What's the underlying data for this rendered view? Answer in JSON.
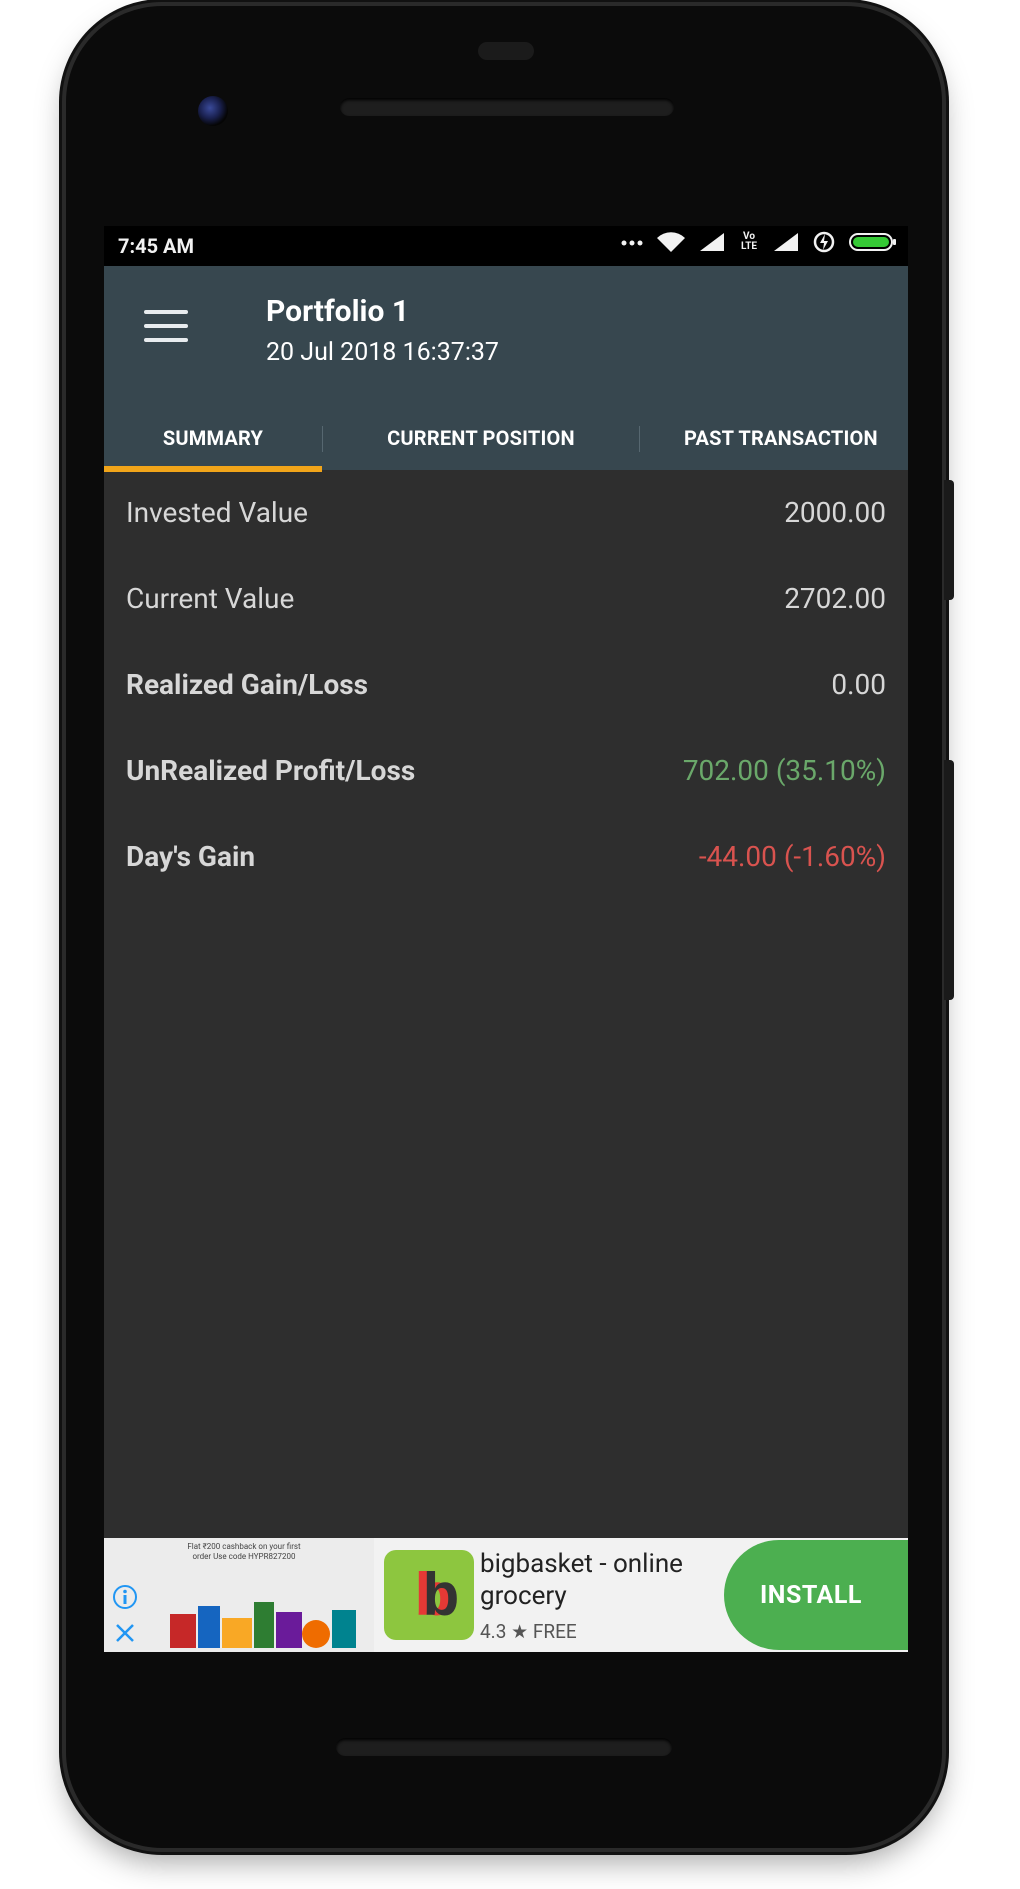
{
  "status_bar": {
    "time": "7:45 AM",
    "network_label": "Vo LTE"
  },
  "app_bar": {
    "title": "Portfolio 1",
    "subtitle": "20 Jul 2018 16:37:37"
  },
  "tabs": [
    {
      "label": "SUMMARY",
      "selected": true
    },
    {
      "label": "CURRENT POSITION",
      "selected": false
    },
    {
      "label": "PAST TRANSACTION",
      "selected": false
    }
  ],
  "summary": [
    {
      "label": "Invested Value",
      "value": "2000.00",
      "bold": false,
      "color": "#d7d7d7"
    },
    {
      "label": "Current Value",
      "value": "2702.00",
      "bold": false,
      "color": "#d7d7d7"
    },
    {
      "label": "Realized Gain/Loss",
      "value": "0.00",
      "bold": true,
      "color": "#d7d7d7"
    },
    {
      "label": "UnRealized Profit/Loss",
      "value": "702.00 (35.10%)",
      "bold": true,
      "color": "#6aa86a"
    },
    {
      "label": "Day's Gain",
      "value": "-44.00 (-1.60%)",
      "bold": true,
      "color": "#d9534f"
    }
  ],
  "ad": {
    "promo_text": "Flat ₹200 cashback on your first order Use code HYPR827200",
    "logo_text": "bb",
    "title": "bigbasket - online grocery",
    "rating": "4.3",
    "price": "FREE",
    "install_label": "INSTALL"
  },
  "colors": {
    "app_bar": "#37474f",
    "tab_indicator": "#f1a51a",
    "background": "#2e2e2e",
    "positive": "#6aa86a",
    "negative": "#d9534f",
    "install": "#4caf50"
  }
}
